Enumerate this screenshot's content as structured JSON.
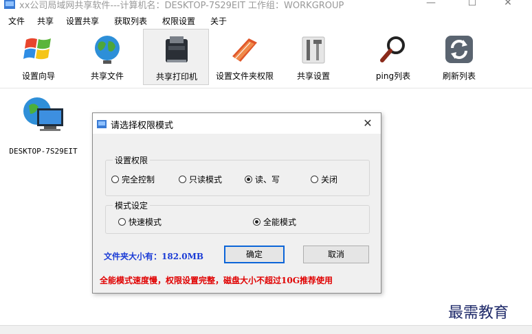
{
  "window": {
    "title": "xx公司局域网共享软件---计算机名：DESKTOP-7S29EIT  工作组：WORKGROUP",
    "minimize": "—",
    "maximize": "☐",
    "close": "✕"
  },
  "menu": [
    "文件",
    "共享",
    "设置共享",
    "获取列表",
    "权限设置",
    "关于"
  ],
  "toolbar": [
    {
      "label": "设置向导",
      "icon": "windows-logo-icon"
    },
    {
      "label": "共享文件",
      "icon": "globe-icon"
    },
    {
      "label": "共享打印机",
      "icon": "printer-icon"
    },
    {
      "label": "设置文件夹权限",
      "icon": "folder-book-icon"
    },
    {
      "label": "共享设置",
      "icon": "tools-icon"
    },
    {
      "label": "ping列表",
      "icon": "magnifier-icon"
    },
    {
      "label": "刷新列表",
      "icon": "refresh-icon"
    }
  ],
  "computer": {
    "name": "DESKTOP-7S29EIT"
  },
  "dialog": {
    "title": "请选择权限模式",
    "close": "✕",
    "permission_group": {
      "label": "设置权限",
      "options": [
        "完全控制",
        "只读模式",
        "读、写",
        "关闭"
      ],
      "selected": "读、写"
    },
    "mode_group": {
      "label": "模式设定",
      "options": [
        "快速模式",
        "全能模式"
      ],
      "selected": "全能模式"
    },
    "size_text": "文件夹大小有：182.0MB",
    "ok_label": "确定",
    "cancel_label": "取消",
    "warning": "全能模式速度慢，权限设置完整，磁盘大小不超过10G推荐使用"
  },
  "watermark": "最需教育",
  "colors": {
    "link_blue": "#1a3bd6",
    "warning_red": "#e00000",
    "accent": "#0a64d8"
  }
}
